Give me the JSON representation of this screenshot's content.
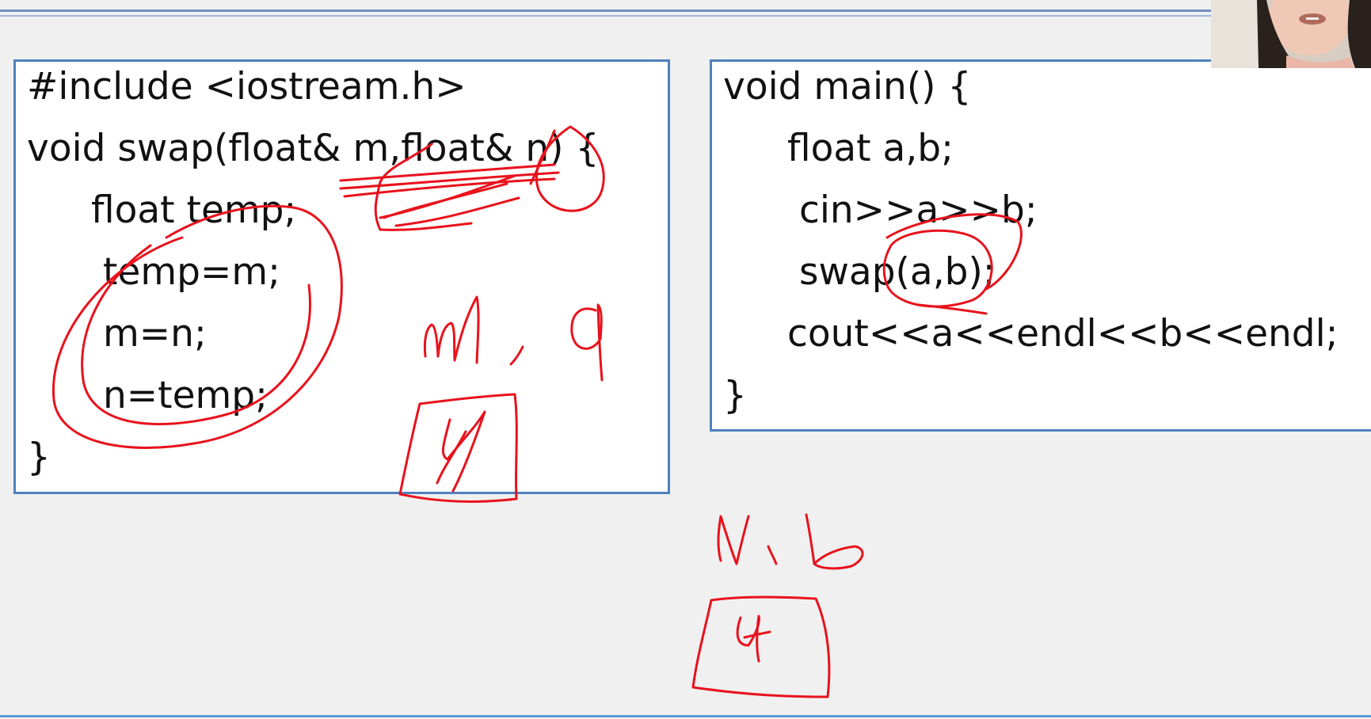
{
  "slide": {
    "left_code": {
      "lines": [
        "#include <iostream.h>",
        "void swap(float& m,float& n) {",
        "float temp;",
        "temp=m;",
        "m=n;",
        "n=temp;",
        "}"
      ]
    },
    "right_code": {
      "lines": [
        "void main() {",
        "float a,b;",
        "cin>>a>>b;",
        "swap(a,b);",
        "cout<<a<<endl<<b<<endl;",
        "}"
      ]
    }
  },
  "annotation": {
    "color": "#e8121c",
    "description_icons": [
      "handwritten-ink"
    ]
  },
  "webcam": {
    "icon": "presenter-video-icon"
  },
  "colors": {
    "box_border": "#4f81bd",
    "background": "#f0f0f0",
    "ink": "#e8121c"
  }
}
